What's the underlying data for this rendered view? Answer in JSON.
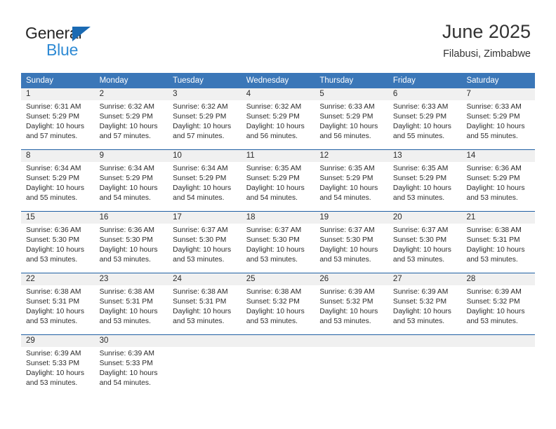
{
  "brand": {
    "name_top": "General",
    "name_bottom": "Blue",
    "flag_icon": "triangle-flag-icon",
    "color_top": "#262626",
    "color_bottom": "#2e8ad4",
    "flag_color": "#1a6ab3"
  },
  "header": {
    "title": "June 2025",
    "subtitle": "Filabusi, Zimbabwe"
  },
  "colors": {
    "header_bar": "#3b77b8",
    "header_text": "#ffffff",
    "row_divider": "#1f5fa3",
    "day_number_bg": "#f0f0f0",
    "cell_bg": "#ffffff",
    "body_text": "#2b2b2b"
  },
  "weekdays": [
    "Sunday",
    "Monday",
    "Tuesday",
    "Wednesday",
    "Thursday",
    "Friday",
    "Saturday"
  ],
  "weeks": [
    [
      {
        "day": "1",
        "sunrise": "Sunrise: 6:31 AM",
        "sunset": "Sunset: 5:29 PM",
        "daylight_1": "Daylight: 10 hours",
        "daylight_2": "and 57 minutes."
      },
      {
        "day": "2",
        "sunrise": "Sunrise: 6:32 AM",
        "sunset": "Sunset: 5:29 PM",
        "daylight_1": "Daylight: 10 hours",
        "daylight_2": "and 57 minutes."
      },
      {
        "day": "3",
        "sunrise": "Sunrise: 6:32 AM",
        "sunset": "Sunset: 5:29 PM",
        "daylight_1": "Daylight: 10 hours",
        "daylight_2": "and 57 minutes."
      },
      {
        "day": "4",
        "sunrise": "Sunrise: 6:32 AM",
        "sunset": "Sunset: 5:29 PM",
        "daylight_1": "Daylight: 10 hours",
        "daylight_2": "and 56 minutes."
      },
      {
        "day": "5",
        "sunrise": "Sunrise: 6:33 AM",
        "sunset": "Sunset: 5:29 PM",
        "daylight_1": "Daylight: 10 hours",
        "daylight_2": "and 56 minutes."
      },
      {
        "day": "6",
        "sunrise": "Sunrise: 6:33 AM",
        "sunset": "Sunset: 5:29 PM",
        "daylight_1": "Daylight: 10 hours",
        "daylight_2": "and 55 minutes."
      },
      {
        "day": "7",
        "sunrise": "Sunrise: 6:33 AM",
        "sunset": "Sunset: 5:29 PM",
        "daylight_1": "Daylight: 10 hours",
        "daylight_2": "and 55 minutes."
      }
    ],
    [
      {
        "day": "8",
        "sunrise": "Sunrise: 6:34 AM",
        "sunset": "Sunset: 5:29 PM",
        "daylight_1": "Daylight: 10 hours",
        "daylight_2": "and 55 minutes."
      },
      {
        "day": "9",
        "sunrise": "Sunrise: 6:34 AM",
        "sunset": "Sunset: 5:29 PM",
        "daylight_1": "Daylight: 10 hours",
        "daylight_2": "and 54 minutes."
      },
      {
        "day": "10",
        "sunrise": "Sunrise: 6:34 AM",
        "sunset": "Sunset: 5:29 PM",
        "daylight_1": "Daylight: 10 hours",
        "daylight_2": "and 54 minutes."
      },
      {
        "day": "11",
        "sunrise": "Sunrise: 6:35 AM",
        "sunset": "Sunset: 5:29 PM",
        "daylight_1": "Daylight: 10 hours",
        "daylight_2": "and 54 minutes."
      },
      {
        "day": "12",
        "sunrise": "Sunrise: 6:35 AM",
        "sunset": "Sunset: 5:29 PM",
        "daylight_1": "Daylight: 10 hours",
        "daylight_2": "and 54 minutes."
      },
      {
        "day": "13",
        "sunrise": "Sunrise: 6:35 AM",
        "sunset": "Sunset: 5:29 PM",
        "daylight_1": "Daylight: 10 hours",
        "daylight_2": "and 53 minutes."
      },
      {
        "day": "14",
        "sunrise": "Sunrise: 6:36 AM",
        "sunset": "Sunset: 5:29 PM",
        "daylight_1": "Daylight: 10 hours",
        "daylight_2": "and 53 minutes."
      }
    ],
    [
      {
        "day": "15",
        "sunrise": "Sunrise: 6:36 AM",
        "sunset": "Sunset: 5:30 PM",
        "daylight_1": "Daylight: 10 hours",
        "daylight_2": "and 53 minutes."
      },
      {
        "day": "16",
        "sunrise": "Sunrise: 6:36 AM",
        "sunset": "Sunset: 5:30 PM",
        "daylight_1": "Daylight: 10 hours",
        "daylight_2": "and 53 minutes."
      },
      {
        "day": "17",
        "sunrise": "Sunrise: 6:37 AM",
        "sunset": "Sunset: 5:30 PM",
        "daylight_1": "Daylight: 10 hours",
        "daylight_2": "and 53 minutes."
      },
      {
        "day": "18",
        "sunrise": "Sunrise: 6:37 AM",
        "sunset": "Sunset: 5:30 PM",
        "daylight_1": "Daylight: 10 hours",
        "daylight_2": "and 53 minutes."
      },
      {
        "day": "19",
        "sunrise": "Sunrise: 6:37 AM",
        "sunset": "Sunset: 5:30 PM",
        "daylight_1": "Daylight: 10 hours",
        "daylight_2": "and 53 minutes."
      },
      {
        "day": "20",
        "sunrise": "Sunrise: 6:37 AM",
        "sunset": "Sunset: 5:30 PM",
        "daylight_1": "Daylight: 10 hours",
        "daylight_2": "and 53 minutes."
      },
      {
        "day": "21",
        "sunrise": "Sunrise: 6:38 AM",
        "sunset": "Sunset: 5:31 PM",
        "daylight_1": "Daylight: 10 hours",
        "daylight_2": "and 53 minutes."
      }
    ],
    [
      {
        "day": "22",
        "sunrise": "Sunrise: 6:38 AM",
        "sunset": "Sunset: 5:31 PM",
        "daylight_1": "Daylight: 10 hours",
        "daylight_2": "and 53 minutes."
      },
      {
        "day": "23",
        "sunrise": "Sunrise: 6:38 AM",
        "sunset": "Sunset: 5:31 PM",
        "daylight_1": "Daylight: 10 hours",
        "daylight_2": "and 53 minutes."
      },
      {
        "day": "24",
        "sunrise": "Sunrise: 6:38 AM",
        "sunset": "Sunset: 5:31 PM",
        "daylight_1": "Daylight: 10 hours",
        "daylight_2": "and 53 minutes."
      },
      {
        "day": "25",
        "sunrise": "Sunrise: 6:38 AM",
        "sunset": "Sunset: 5:32 PM",
        "daylight_1": "Daylight: 10 hours",
        "daylight_2": "and 53 minutes."
      },
      {
        "day": "26",
        "sunrise": "Sunrise: 6:39 AM",
        "sunset": "Sunset: 5:32 PM",
        "daylight_1": "Daylight: 10 hours",
        "daylight_2": "and 53 minutes."
      },
      {
        "day": "27",
        "sunrise": "Sunrise: 6:39 AM",
        "sunset": "Sunset: 5:32 PM",
        "daylight_1": "Daylight: 10 hours",
        "daylight_2": "and 53 minutes."
      },
      {
        "day": "28",
        "sunrise": "Sunrise: 6:39 AM",
        "sunset": "Sunset: 5:32 PM",
        "daylight_1": "Daylight: 10 hours",
        "daylight_2": "and 53 minutes."
      }
    ],
    [
      {
        "day": "29",
        "sunrise": "Sunrise: 6:39 AM",
        "sunset": "Sunset: 5:33 PM",
        "daylight_1": "Daylight: 10 hours",
        "daylight_2": "and 53 minutes."
      },
      {
        "day": "30",
        "sunrise": "Sunrise: 6:39 AM",
        "sunset": "Sunset: 5:33 PM",
        "daylight_1": "Daylight: 10 hours",
        "daylight_2": "and 54 minutes."
      },
      {
        "day": "",
        "sunrise": "",
        "sunset": "",
        "daylight_1": "",
        "daylight_2": ""
      },
      {
        "day": "",
        "sunrise": "",
        "sunset": "",
        "daylight_1": "",
        "daylight_2": ""
      },
      {
        "day": "",
        "sunrise": "",
        "sunset": "",
        "daylight_1": "",
        "daylight_2": ""
      },
      {
        "day": "",
        "sunrise": "",
        "sunset": "",
        "daylight_1": "",
        "daylight_2": ""
      },
      {
        "day": "",
        "sunrise": "",
        "sunset": "",
        "daylight_1": "",
        "daylight_2": ""
      }
    ]
  ]
}
